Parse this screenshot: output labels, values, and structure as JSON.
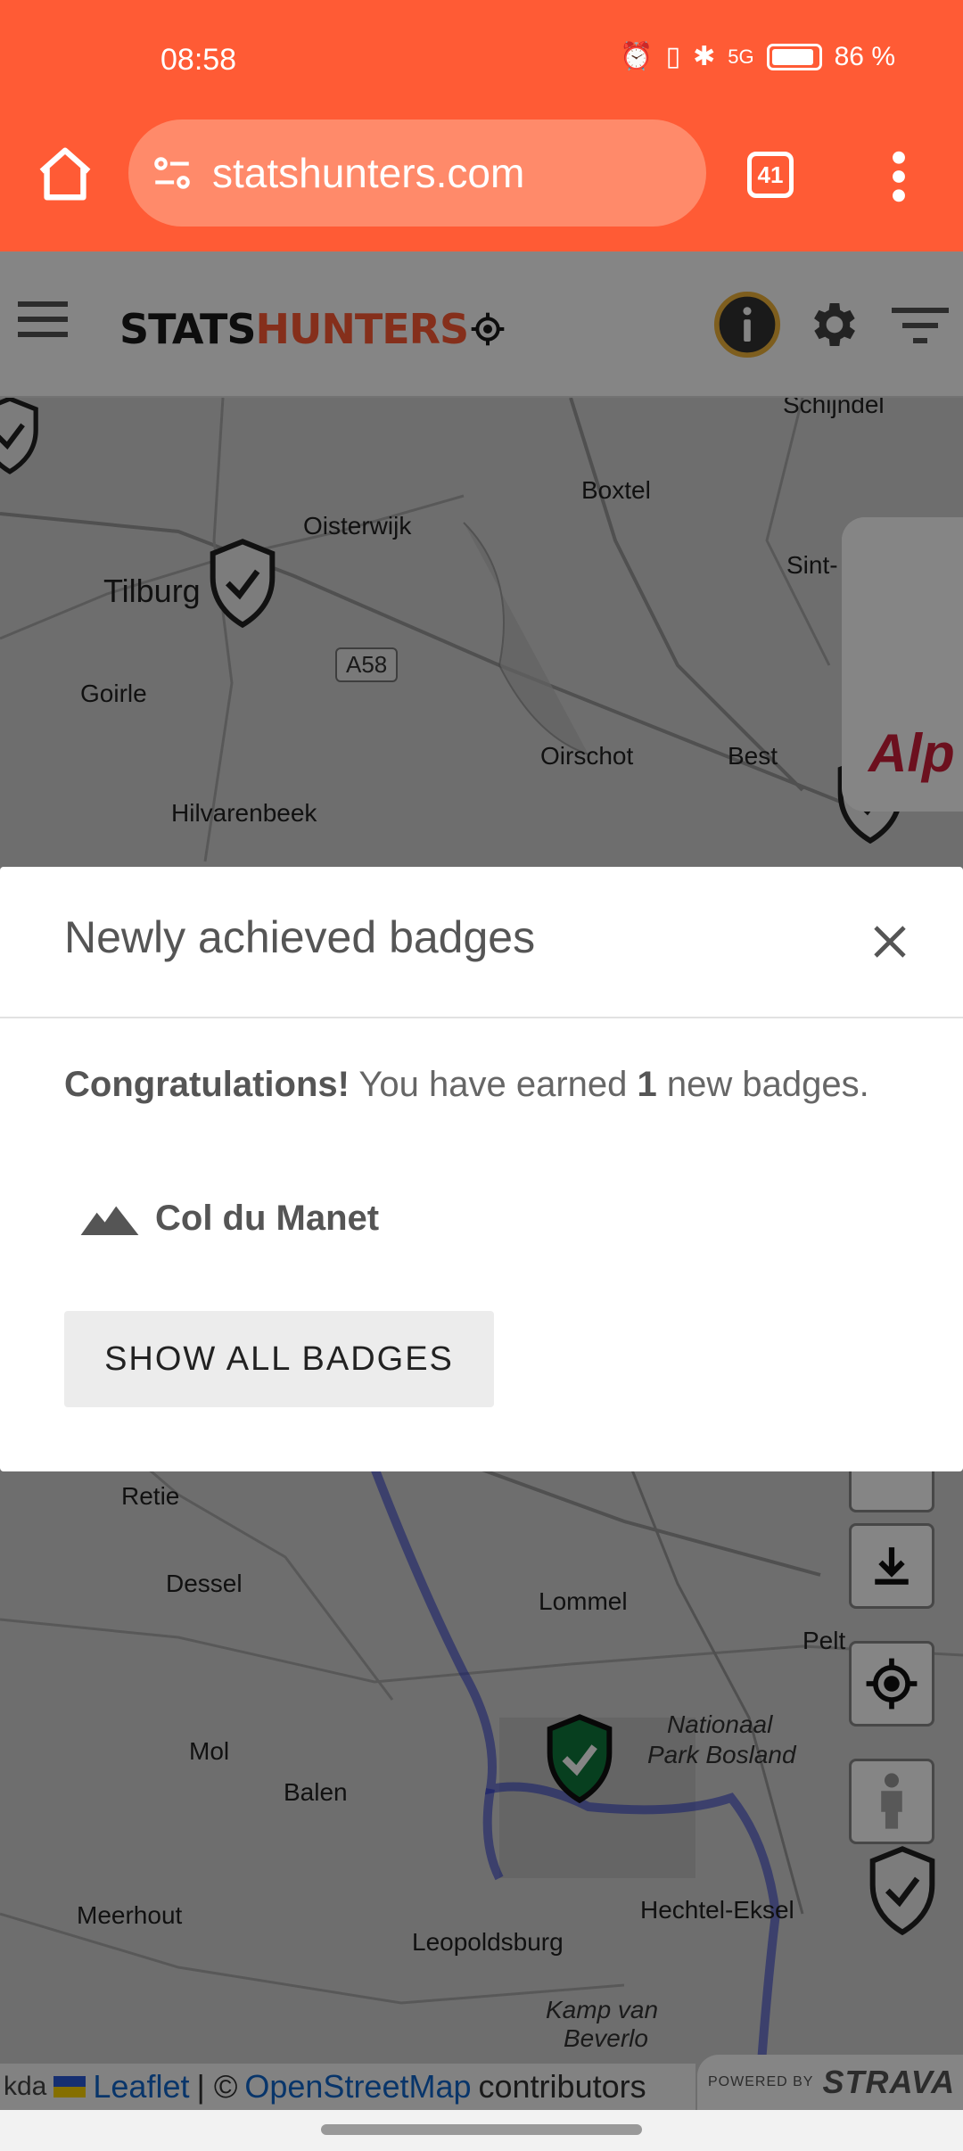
{
  "status_bar": {
    "time": "08:58",
    "battery": "86 %",
    "network": "5G"
  },
  "browser": {
    "url": "statshunters.com",
    "tab_count": "41",
    "icons": [
      "home-icon",
      "site-settings-icon",
      "tabs-icon",
      "more-vert-icon"
    ]
  },
  "app_header": {
    "logo_part1": "STATS",
    "logo_part2": "HUNTERS",
    "icons": [
      "menu-icon",
      "info-icon",
      "gear-icon",
      "filter-icon"
    ]
  },
  "map": {
    "places": [
      "Schijndel",
      "Boxtel",
      "Oisterwijk",
      "Tilburg",
      "Sint-",
      "Goirle",
      "Oirschot",
      "Best",
      "Hilvarenbeek",
      "Retie",
      "Dessel",
      "Lommel",
      "Pelt",
      "Mol",
      "Balen",
      "Nationaal",
      "Park Bosland",
      "Meerhout",
      "Hechtel-Eksel",
      "Leopoldsburg",
      "Kamp van",
      "Beverlo",
      "Pe",
      "kda"
    ],
    "road": "A58",
    "ad_text": "Alp",
    "accent_color": "#ff5b35",
    "route_color": "#2233cc"
  },
  "attribution": {
    "leaflet": "Leaflet",
    "separator": "| ©",
    "osm": "OpenStreetMap",
    "contributors": "contributors",
    "powered_by": "POWERED BY",
    "strava": "STRAVA"
  },
  "dialog": {
    "title": "Newly achieved badges",
    "congrats": "Congratulations!",
    "msg_pre": "You have earned",
    "count": "1",
    "msg_post": "new badges.",
    "badge_name": "Col du Manet",
    "button_label": "SHOW ALL BADGES"
  }
}
